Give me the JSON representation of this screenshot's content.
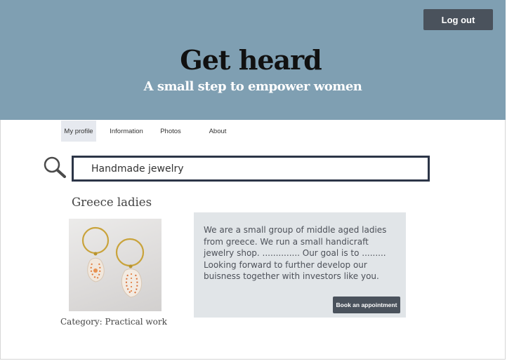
{
  "header": {
    "title": "Get heard",
    "subtitle": "A small step to empower women",
    "logout_label": "Log out",
    "background_color": "#7f9fb2"
  },
  "nav": {
    "tabs": [
      {
        "label": "My profile",
        "active": true
      },
      {
        "label": "Information",
        "active": false
      },
      {
        "label": "Photos",
        "active": false
      },
      {
        "label": "About",
        "active": false
      }
    ]
  },
  "search": {
    "value": "Handmade jewelry",
    "icon": "search-icon"
  },
  "profile": {
    "name": "Greece ladies",
    "photo_icon": "earrings-photo",
    "category": "Category: Practical work",
    "description": "We are a small group of  middle aged ladies\nfrom greece. We run a small handicraft\njewelry shop. .............. Our goal is to .........\nLooking forward to further develop our\nbuisness together with investors like you.",
    "book_label": "Book an appointment"
  }
}
